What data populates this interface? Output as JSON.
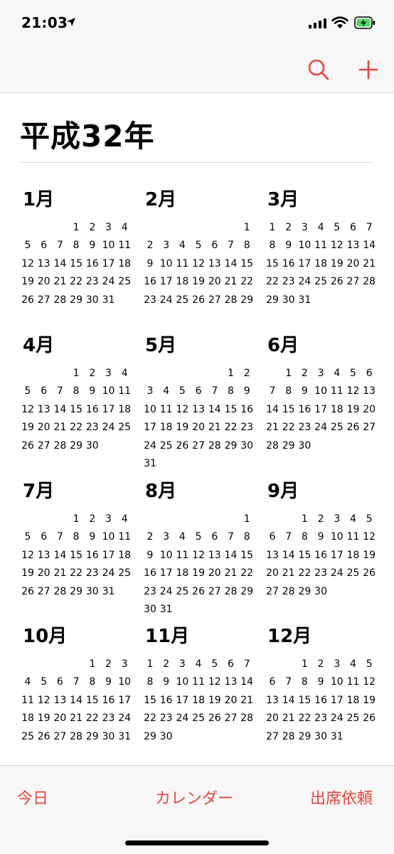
{
  "status_bar": {
    "time": "21:03"
  },
  "nav": {
    "search_icon": "search-icon",
    "add_icon": "plus-icon",
    "accent": "#e8453c"
  },
  "title": "平成32年",
  "months": [
    {
      "name": "1月",
      "offset": 3,
      "days": 31
    },
    {
      "name": "2月",
      "offset": 6,
      "days": 29
    },
    {
      "name": "3月",
      "offset": 0,
      "days": 31
    },
    {
      "name": "4月",
      "offset": 3,
      "days": 30
    },
    {
      "name": "5月",
      "offset": 5,
      "days": 31
    },
    {
      "name": "6月",
      "offset": 1,
      "days": 30
    },
    {
      "name": "7月",
      "offset": 3,
      "days": 31
    },
    {
      "name": "8月",
      "offset": 6,
      "days": 31
    },
    {
      "name": "9月",
      "offset": 2,
      "days": 30
    },
    {
      "name": "10月",
      "offset": 4,
      "days": 31
    },
    {
      "name": "11月",
      "offset": 0,
      "days": 30
    },
    {
      "name": "12月",
      "offset": 2,
      "days": 31
    }
  ],
  "tab_bar": {
    "today": "今日",
    "calendars": "カレンダー",
    "inbox": "出席依頼"
  }
}
